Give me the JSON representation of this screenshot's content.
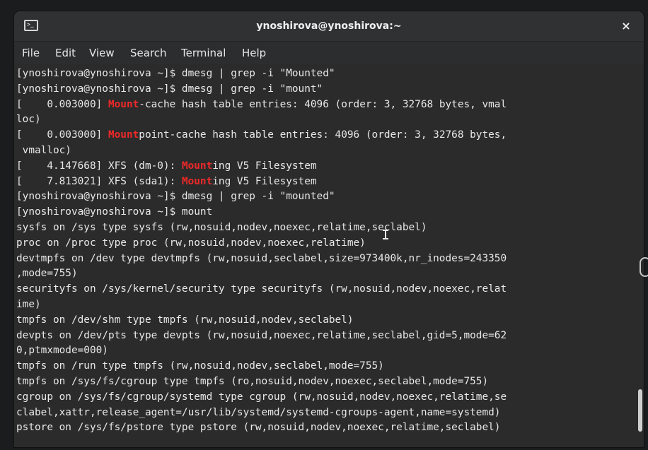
{
  "window": {
    "title": "ynoshirova@ynoshirova:~",
    "terminal_icon": "terminal-icon",
    "close_icon": "close-icon",
    "close_glyph": "×"
  },
  "menu": {
    "file": "File",
    "edit": "Edit",
    "view": "View",
    "search": "Search",
    "terminal": "Terminal",
    "help": "Help"
  },
  "colors": {
    "background": "#2b2b2b",
    "text": "#e8e8e8",
    "highlight": "#ef2929"
  },
  "terminal": {
    "lines": [
      {
        "parts": [
          {
            "text": "[ynoshirova@ynoshirova ~]$ dmesg | grep -i \"Mounted\""
          }
        ]
      },
      {
        "parts": [
          {
            "text": "[ynoshirova@ynoshirova ~]$ dmesg | grep -i \"mount\""
          }
        ]
      },
      {
        "parts": [
          {
            "text": "[    0.003000] "
          },
          {
            "text": "Mount",
            "hl": true
          },
          {
            "text": "-cache hash table entries: 4096 (order: 3, 32768 bytes, vmal"
          }
        ]
      },
      {
        "parts": [
          {
            "text": "loc)"
          }
        ]
      },
      {
        "parts": [
          {
            "text": "[    0.003000] "
          },
          {
            "text": "Mount",
            "hl": true
          },
          {
            "text": "point-cache hash table entries: 4096 (order: 3, 32768 bytes,"
          }
        ]
      },
      {
        "parts": [
          {
            "text": " vmalloc)"
          }
        ]
      },
      {
        "parts": [
          {
            "text": "[    4.147668] XFS (dm-0): "
          },
          {
            "text": "Mount",
            "hl": true
          },
          {
            "text": "ing V5 Filesystem"
          }
        ]
      },
      {
        "parts": [
          {
            "text": "[    7.813021] XFS (sda1): "
          },
          {
            "text": "Mount",
            "hl": true
          },
          {
            "text": "ing V5 Filesystem"
          }
        ]
      },
      {
        "parts": [
          {
            "text": "[ynoshirova@ynoshirova ~]$ dmesg | grep -i \"mounted\""
          }
        ]
      },
      {
        "parts": [
          {
            "text": "[ynoshirova@ynoshirova ~]$ mount"
          }
        ]
      },
      {
        "parts": [
          {
            "text": "sysfs on /sys type sysfs (rw,nosuid,nodev,noexec,relatime,seclabel)"
          }
        ]
      },
      {
        "parts": [
          {
            "text": "proc on /proc type proc (rw,nosuid,nodev,noexec,relatime)"
          }
        ]
      },
      {
        "parts": [
          {
            "text": "devtmpfs on /dev type devtmpfs (rw,nosuid,seclabel,size=973400k,nr_inodes=243350"
          }
        ]
      },
      {
        "parts": [
          {
            "text": ",mode=755)"
          }
        ]
      },
      {
        "parts": [
          {
            "text": "securityfs on /sys/kernel/security type securityfs (rw,nosuid,nodev,noexec,relat"
          }
        ]
      },
      {
        "parts": [
          {
            "text": "ime)"
          }
        ]
      },
      {
        "parts": [
          {
            "text": "tmpfs on /dev/shm type tmpfs (rw,nosuid,nodev,seclabel)"
          }
        ]
      },
      {
        "parts": [
          {
            "text": "devpts on /dev/pts type devpts (rw,nosuid,noexec,relatime,seclabel,gid=5,mode=62"
          }
        ]
      },
      {
        "parts": [
          {
            "text": "0,ptmxmode=000)"
          }
        ]
      },
      {
        "parts": [
          {
            "text": "tmpfs on /run type tmpfs (rw,nosuid,nodev,seclabel,mode=755)"
          }
        ]
      },
      {
        "parts": [
          {
            "text": "tmpfs on /sys/fs/cgroup type tmpfs (ro,nosuid,nodev,noexec,seclabel,mode=755)"
          }
        ]
      },
      {
        "parts": [
          {
            "text": "cgroup on /sys/fs/cgroup/systemd type cgroup (rw,nosuid,nodev,noexec,relatime,se"
          }
        ]
      },
      {
        "parts": [
          {
            "text": "clabel,xattr,release_agent=/usr/lib/systemd/systemd-cgroups-agent,name=systemd)"
          }
        ]
      },
      {
        "parts": [
          {
            "text": "pstore on /sys/fs/pstore type pstore (rw,nosuid,nodev,noexec,relatime,seclabel)"
          }
        ]
      }
    ]
  }
}
